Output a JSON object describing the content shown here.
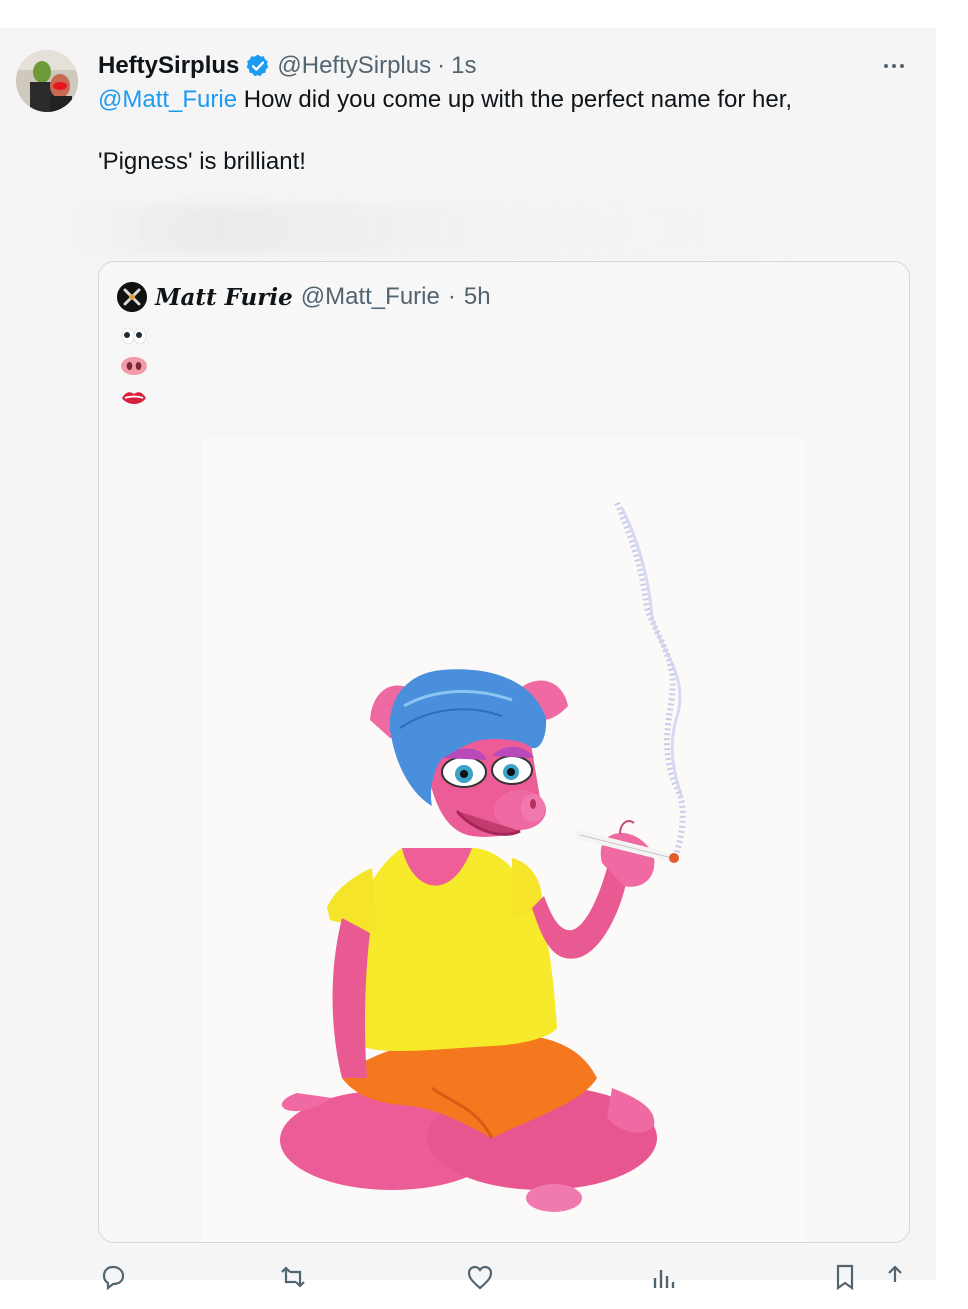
{
  "tweet": {
    "author_name": "HeftySirplus",
    "author_handle": "@HeftySirplus",
    "separator": "·",
    "time": "1s",
    "mention": "@Matt_Furie",
    "text_line1": " How did you come up with the perfect name for her,",
    "text_line2": "'Pigness' is brilliant!"
  },
  "quoted_tweet": {
    "author_name": "Matt Furie",
    "author_handle": "@Matt_Furie",
    "separator": "·",
    "time": "5h",
    "emojis": [
      "eyes",
      "pig-nose",
      "lips"
    ]
  },
  "icons": {
    "verified": "verified-badge-icon",
    "more": "more-options-icon",
    "actions": [
      "reply-icon",
      "retweet-icon",
      "like-icon",
      "views-icon",
      "bookmark-icon",
      "share-icon"
    ]
  },
  "colors": {
    "link": "#1d9bf0",
    "verified": "#1d9bf0",
    "muted": "#536471"
  }
}
